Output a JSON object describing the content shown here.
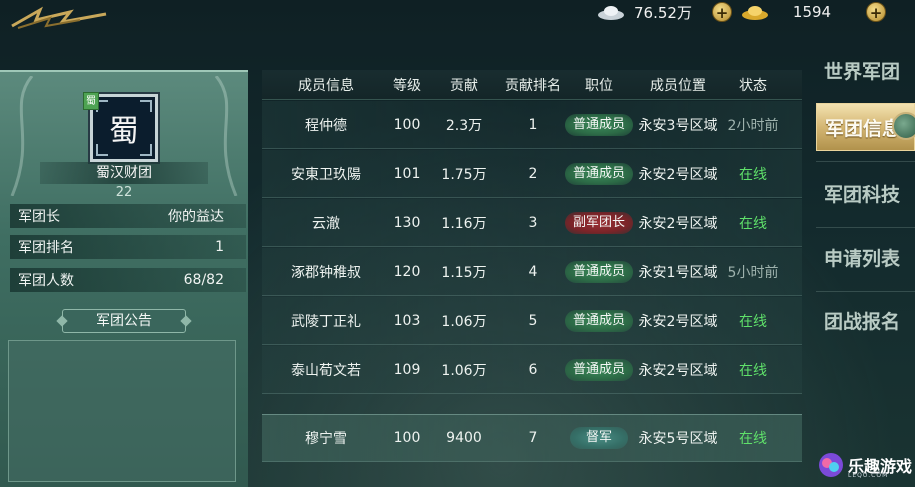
{
  "currency": {
    "silver": {
      "icon": "silver-ingot-icon",
      "value": "76.52万"
    },
    "gold": {
      "icon": "gold-ingot-icon",
      "value": "1594"
    }
  },
  "guild": {
    "emblem_char": "蜀",
    "faction": "蜀",
    "name": "蜀汉财团",
    "level": "22",
    "info": [
      {
        "label": "军团长",
        "value": "你的益达"
      },
      {
        "label": "军团排名",
        "value": "1"
      },
      {
        "label": "军团人数",
        "value": "68/82"
      }
    ],
    "notice_title": "军团公告",
    "notice_text": ""
  },
  "table": {
    "headers": [
      "成员信息",
      "等级",
      "贡献",
      "贡献排名",
      "职位",
      "成员位置",
      "状态"
    ],
    "rows": [
      {
        "name": "程仲德",
        "level": "100",
        "contribution": "2.3万",
        "rank": "1",
        "role": "普通成员",
        "role_type": "normal",
        "location": "永安3号区域",
        "status": "2小时前",
        "online": false
      },
      {
        "name": "安東卫玖陽",
        "level": "101",
        "contribution": "1.75万",
        "rank": "2",
        "role": "普通成员",
        "role_type": "normal",
        "location": "永安2号区域",
        "status": "在线",
        "online": true
      },
      {
        "name": "云澈",
        "level": "130",
        "contribution": "1.16万",
        "rank": "3",
        "role": "副军团长",
        "role_type": "vice",
        "location": "永安2号区域",
        "status": "在线",
        "online": true
      },
      {
        "name": "涿郡钟稚叔",
        "level": "120",
        "contribution": "1.15万",
        "rank": "4",
        "role": "普通成员",
        "role_type": "normal",
        "location": "永安1号区域",
        "status": "5小时前",
        "online": false
      },
      {
        "name": "武陵丁正礼",
        "level": "103",
        "contribution": "1.06万",
        "rank": "5",
        "role": "普通成员",
        "role_type": "normal",
        "location": "永安2号区域",
        "status": "在线",
        "online": true
      },
      {
        "name": "泰山荀文若",
        "level": "109",
        "contribution": "1.06万",
        "rank": "6",
        "role": "普通成员",
        "role_type": "normal",
        "location": "永安2号区域",
        "status": "在线",
        "online": true
      }
    ],
    "self_row": {
      "name": "穆宁雪",
      "level": "100",
      "contribution": "9400",
      "rank": "7",
      "role": "督军",
      "role_type": "super",
      "location": "永安5号区域",
      "status": "在线",
      "online": true
    }
  },
  "tabs": [
    {
      "label": "世界军团",
      "active": false
    },
    {
      "label": "军团信息",
      "active": true
    },
    {
      "label": "军团科技",
      "active": false
    },
    {
      "label": "申请列表",
      "active": false
    },
    {
      "label": "团战报名",
      "active": false
    }
  ],
  "watermark": {
    "text": "乐趣游戏",
    "sub": "LEQU.COM"
  },
  "colors": {
    "online": "#5fe06a",
    "offline": "#9eb2ad",
    "active_tab": "#d4b673"
  }
}
